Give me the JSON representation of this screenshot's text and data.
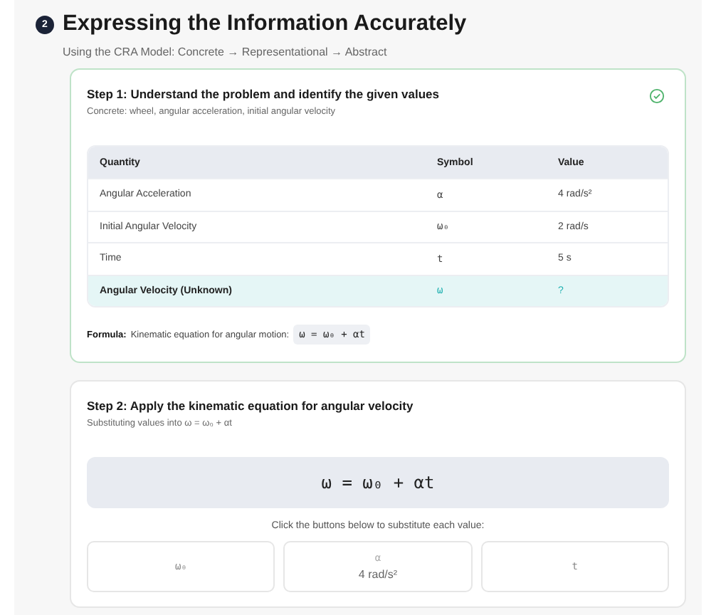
{
  "section": {
    "number": "2",
    "title": "Expressing the Information Accurately",
    "subtitle": "Using the CRA Model: Concrete → Representational → Abstract"
  },
  "step1": {
    "title": "Step 1: Understand the problem and identify the given values",
    "subtitle": "Concrete: wheel, angular acceleration, initial angular velocity",
    "completed": true,
    "table": {
      "columns": [
        "Quantity",
        "Symbol",
        "Value"
      ],
      "rows": [
        {
          "quantity": "Angular Acceleration",
          "symbol": "α",
          "value": "4 rad/s²",
          "highlighted": false
        },
        {
          "quantity": "Initial Angular Velocity",
          "symbol": "ω₀",
          "value": "2 rad/s",
          "highlighted": false
        },
        {
          "quantity": "Time",
          "symbol": "t",
          "value": "5 s",
          "highlighted": false
        },
        {
          "quantity": "Angular Velocity (Unknown)",
          "symbol": "ω",
          "value": "?",
          "highlighted": true
        }
      ]
    },
    "formula_label": "Formula:",
    "formula_text": "Kinematic equation for angular motion:",
    "formula": "ω = ω₀ + αt"
  },
  "step2": {
    "title": "Step 2: Apply the kinematic equation for angular velocity",
    "subtitle": "Substituting values into ω = ω₀ + αt",
    "completed": false,
    "equation": "ω = ω₀ + αt",
    "hint": "Click the buttons below to substitute each value:",
    "buttons": [
      {
        "symbol": "ω₀",
        "substituted": false
      },
      {
        "symbol": "α",
        "value": "4 rad/s²",
        "substituted": true
      },
      {
        "symbol": "t",
        "substituted": false
      }
    ]
  }
}
